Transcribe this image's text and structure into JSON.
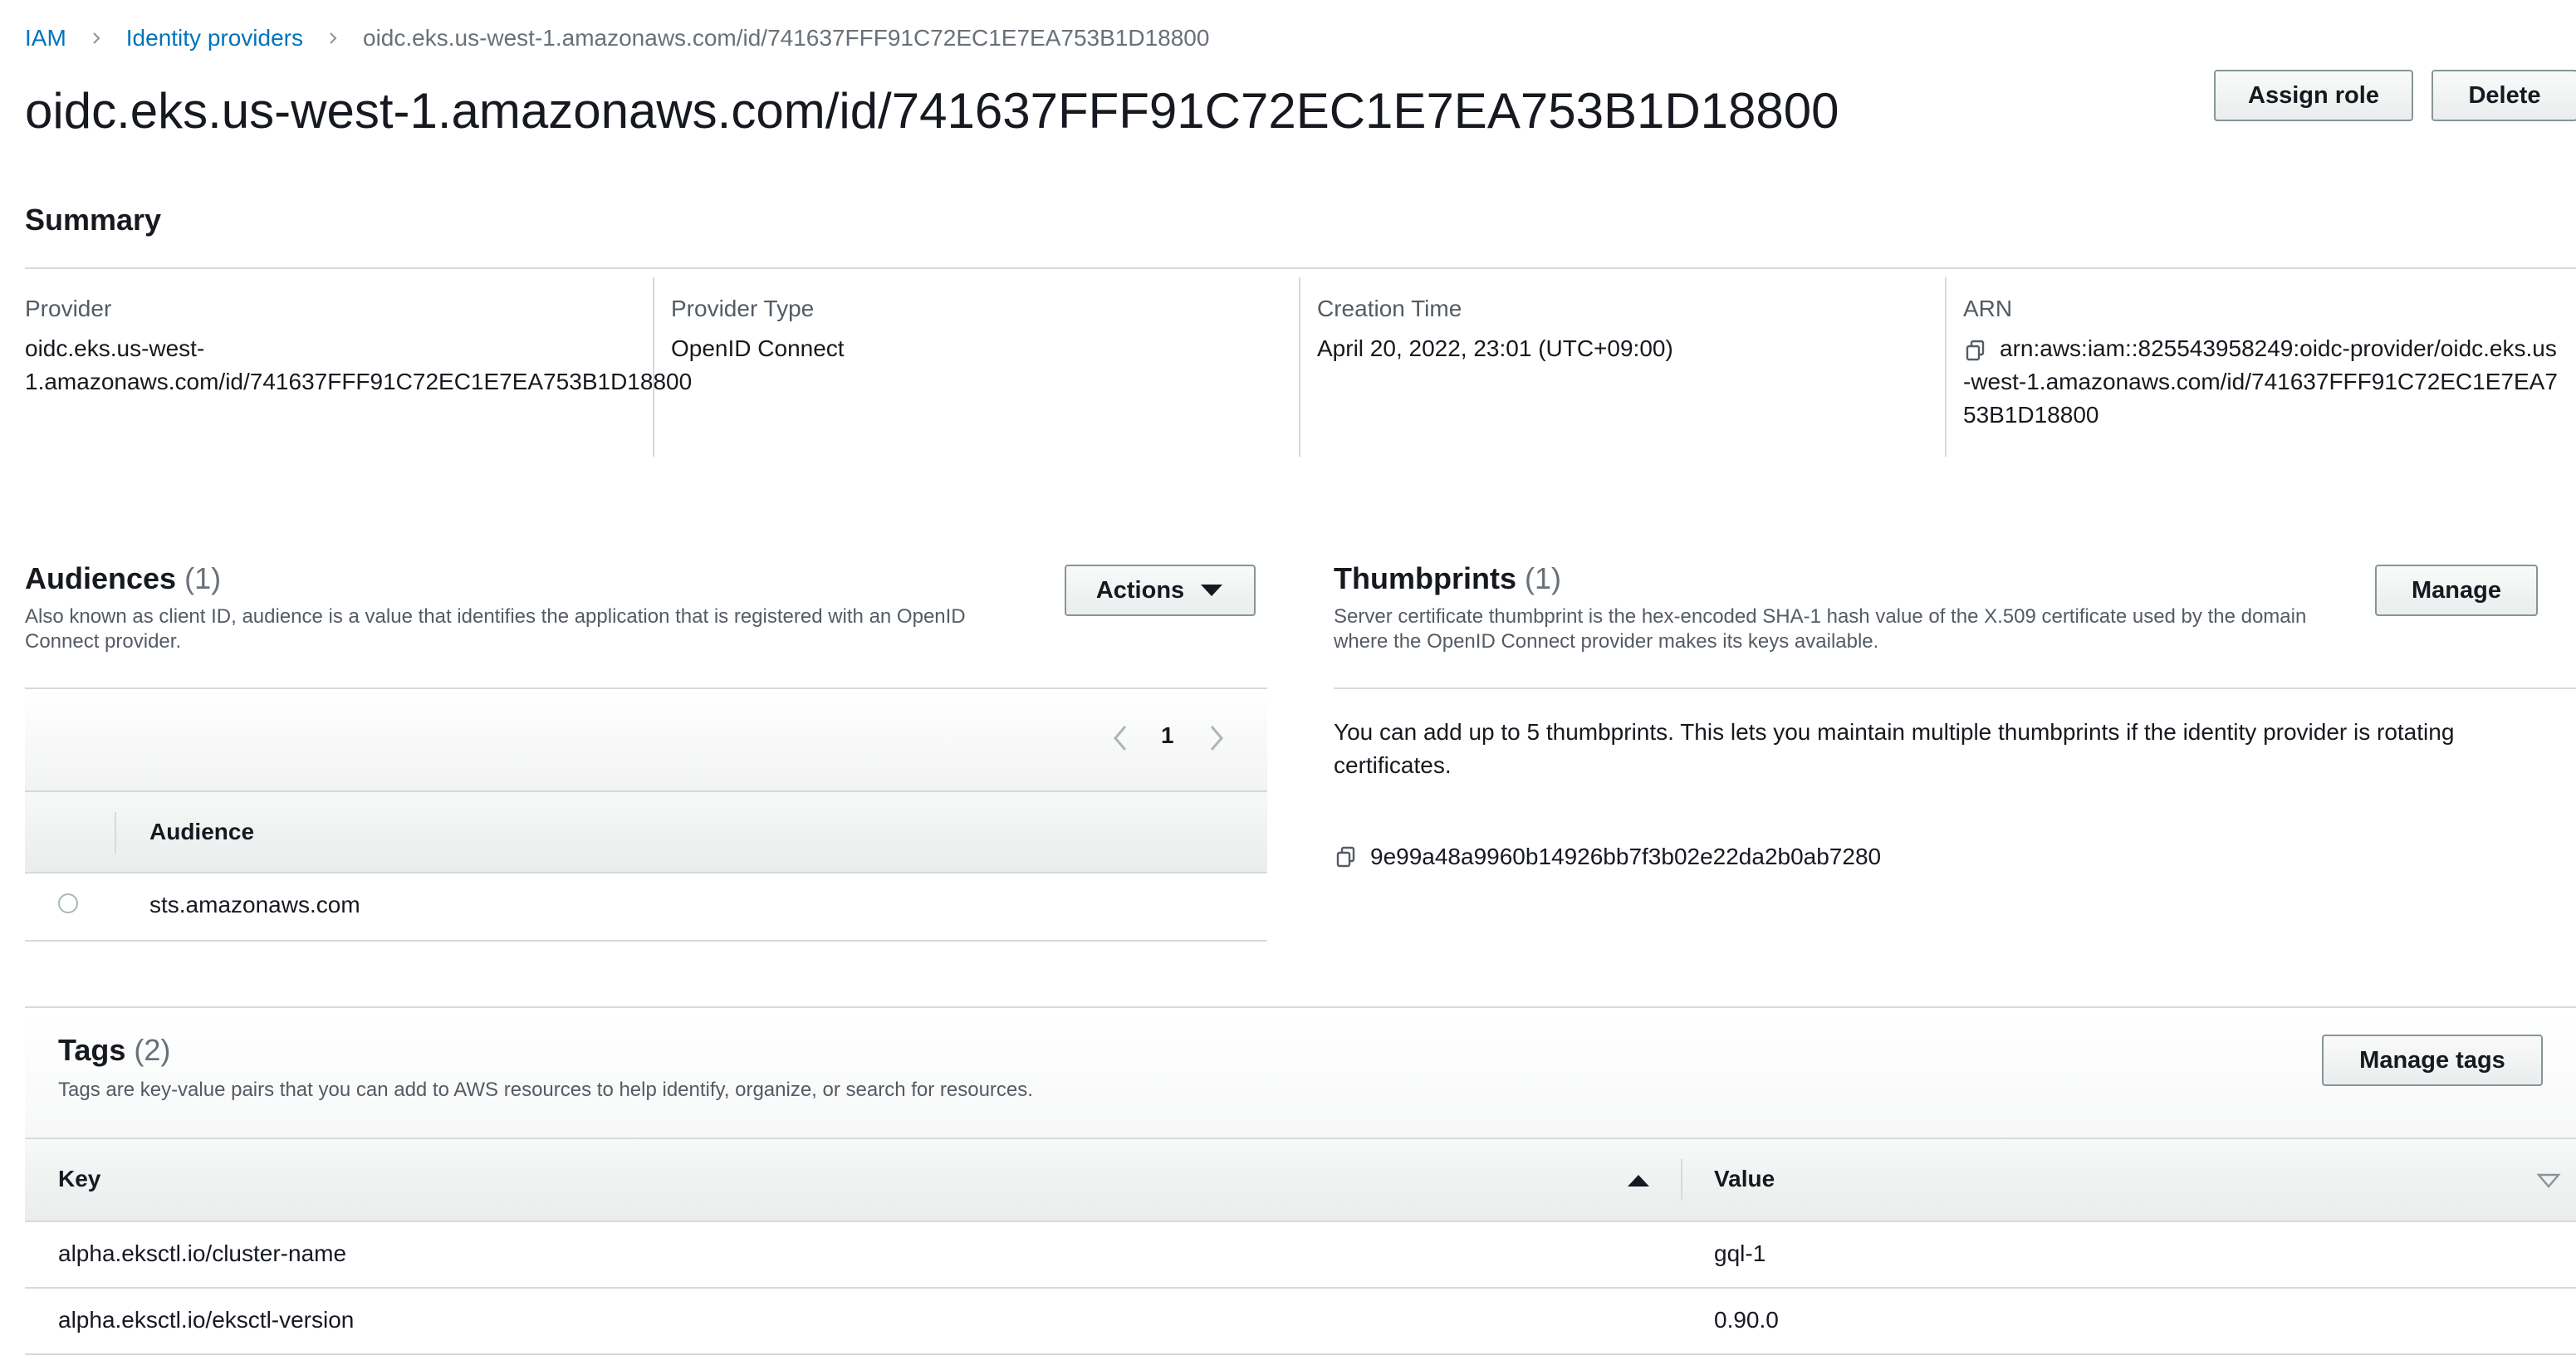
{
  "breadcrumb": {
    "iam": "IAM",
    "identity_providers": "Identity providers",
    "current": "oidc.eks.us-west-1.amazonaws.com/id/741637FFF91C72EC1E7EA753B1D18800"
  },
  "page_title": "oidc.eks.us-west-1.amazonaws.com/id/741637FFF91C72EC1E7EA753B1D18800",
  "header_buttons": {
    "assign_role": "Assign role",
    "delete": "Delete"
  },
  "summary": {
    "title": "Summary",
    "provider_label": "Provider",
    "provider_value_line1": "oidc.eks.us-west-",
    "provider_value_line2": "1.amazonaws.com/id/741637FFF91C72EC1E7EA753B1D18800",
    "provider_type_label": "Provider Type",
    "provider_type_value": "OpenID Connect",
    "creation_time_label": "Creation Time",
    "creation_time_value": "April 20, 2022, 23:01 (UTC+09:00)",
    "arn_label": "ARN",
    "arn_line1": "arn:aws:iam::825543958249:oidc-provider/oidc.eks.us",
    "arn_line2": "-west-1.amazonaws.com/id/741637FFF91C72EC1E7EA7",
    "arn_line3": "53B1D18800"
  },
  "audiences": {
    "title": "Audiences",
    "count": "(1)",
    "description_line1": "Also known as client ID, audience is a value that identifies the application that is registered with an OpenID",
    "description_line2": "Connect provider.",
    "actions_label": "Actions",
    "page_number": "1",
    "column_header": "Audience",
    "rows": [
      {
        "value": "sts.amazonaws.com"
      }
    ]
  },
  "thumbprints": {
    "title": "Thumbprints",
    "count": "(1)",
    "description_line1": "Server certificate thumbprint is the hex-encoded SHA-1 hash value of the X.509 certificate used by the domain",
    "description_line2": "where the OpenID Connect provider makes its keys available.",
    "manage_label": "Manage",
    "info_line1": "You can add up to 5 thumbprints. This lets you maintain multiple thumbprints if the identity provider is rotating",
    "info_line2": "certificates.",
    "items": [
      "9e99a48a9960b14926bb7f3b02e22da2b0ab7280"
    ]
  },
  "tags": {
    "title": "Tags",
    "count": "(2)",
    "description": "Tags are key-value pairs that you can add to AWS resources to help identify, organize, or search for resources.",
    "manage_label": "Manage tags",
    "key_header": "Key",
    "value_header": "Value",
    "rows": [
      {
        "key": "alpha.eksctl.io/cluster-name",
        "value": "gql-1"
      },
      {
        "key": "alpha.eksctl.io/eksctl-version",
        "value": "0.90.0"
      }
    ]
  },
  "colors": {
    "link": "#0073bb",
    "border": "#d5dbdb",
    "header_bg": "#eaeded",
    "muted": "#687078"
  }
}
